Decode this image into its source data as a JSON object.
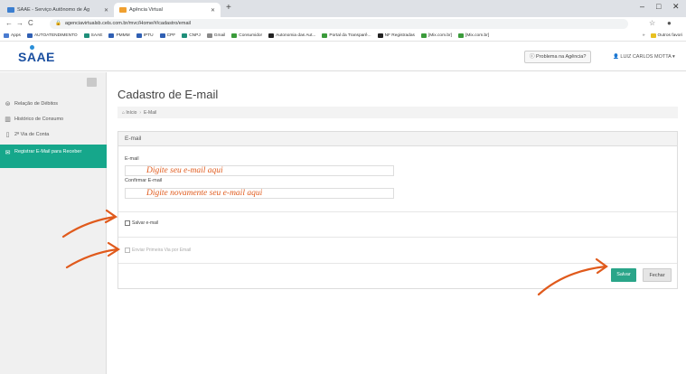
{
  "browser": {
    "tabs": [
      {
        "title": "SAAE - Serviço Autônomo de Ág",
        "active": false
      },
      {
        "title": "Agência Virtual",
        "active": true
      }
    ],
    "new_tab": "+",
    "window_controls": {
      "minimize": "–",
      "maximize": "□",
      "close": "✕"
    },
    "url": "agenciavirtualsb.cels.com.br/mvc/Home/#/cadastro/email",
    "bookmarks": [
      {
        "label": "Apps",
        "icon": "grid"
      },
      {
        "label": "AUTOATENDIMENTO",
        "icon": "blue"
      },
      {
        "label": "SAAE",
        "icon": "teal"
      },
      {
        "label": "PMMM",
        "icon": "blue"
      },
      {
        "label": "IPTU",
        "icon": "blue"
      },
      {
        "label": "CPF",
        "icon": "blue"
      },
      {
        "label": "CNPJ",
        "icon": "teal"
      },
      {
        "label": "Gmail",
        "icon": "gray"
      },
      {
        "label": "Consumidor",
        "icon": "green"
      },
      {
        "label": "Autonomia das Aut...",
        "icon": "dark"
      },
      {
        "label": "Portal da Transparê...",
        "icon": "green"
      },
      {
        "label": "NF Registradas",
        "icon": "dark"
      },
      {
        "label": "[Mix.com.br]",
        "icon": "green"
      },
      {
        "label": "[Mix.com.br]",
        "icon": "green"
      }
    ],
    "bookmarks_overflow": "»",
    "bookmarks_other": "Outros favori"
  },
  "header": {
    "logo": "SAAE",
    "problem_button": "Problema na Agência?",
    "user": "LUIZ CARLOS MOTTA"
  },
  "sidebar": {
    "items": [
      {
        "label": "Relação de Débitos",
        "icon": "list-icon"
      },
      {
        "label": "Histórico de Consumo",
        "icon": "chart-icon"
      },
      {
        "label": "2ª Via de Conta",
        "icon": "document-icon"
      },
      {
        "label": "Registrar E-Mail para Receber",
        "icon": "email-icon",
        "active": true
      }
    ]
  },
  "main": {
    "title": "Cadastro de E-mail",
    "breadcrumb": {
      "home": "Início",
      "current": "E-Mail"
    },
    "panel_title": "E-mail",
    "email_label": "E-mail",
    "email_value": "Digite seu e-mail aqui",
    "confirm_label": "Confirmar E-mail",
    "confirm_value": "Digite novamente seu e-mail aqui",
    "save_email_label": "Salvar e-mail",
    "send_first_copy_label": "Enviar Primeira Via por Email",
    "save_button": "Salvar",
    "close_button": "Fechar"
  },
  "colors": {
    "accent": "#16a78b",
    "annotation": "#e05a1c",
    "logo": "#1a4fa0"
  }
}
